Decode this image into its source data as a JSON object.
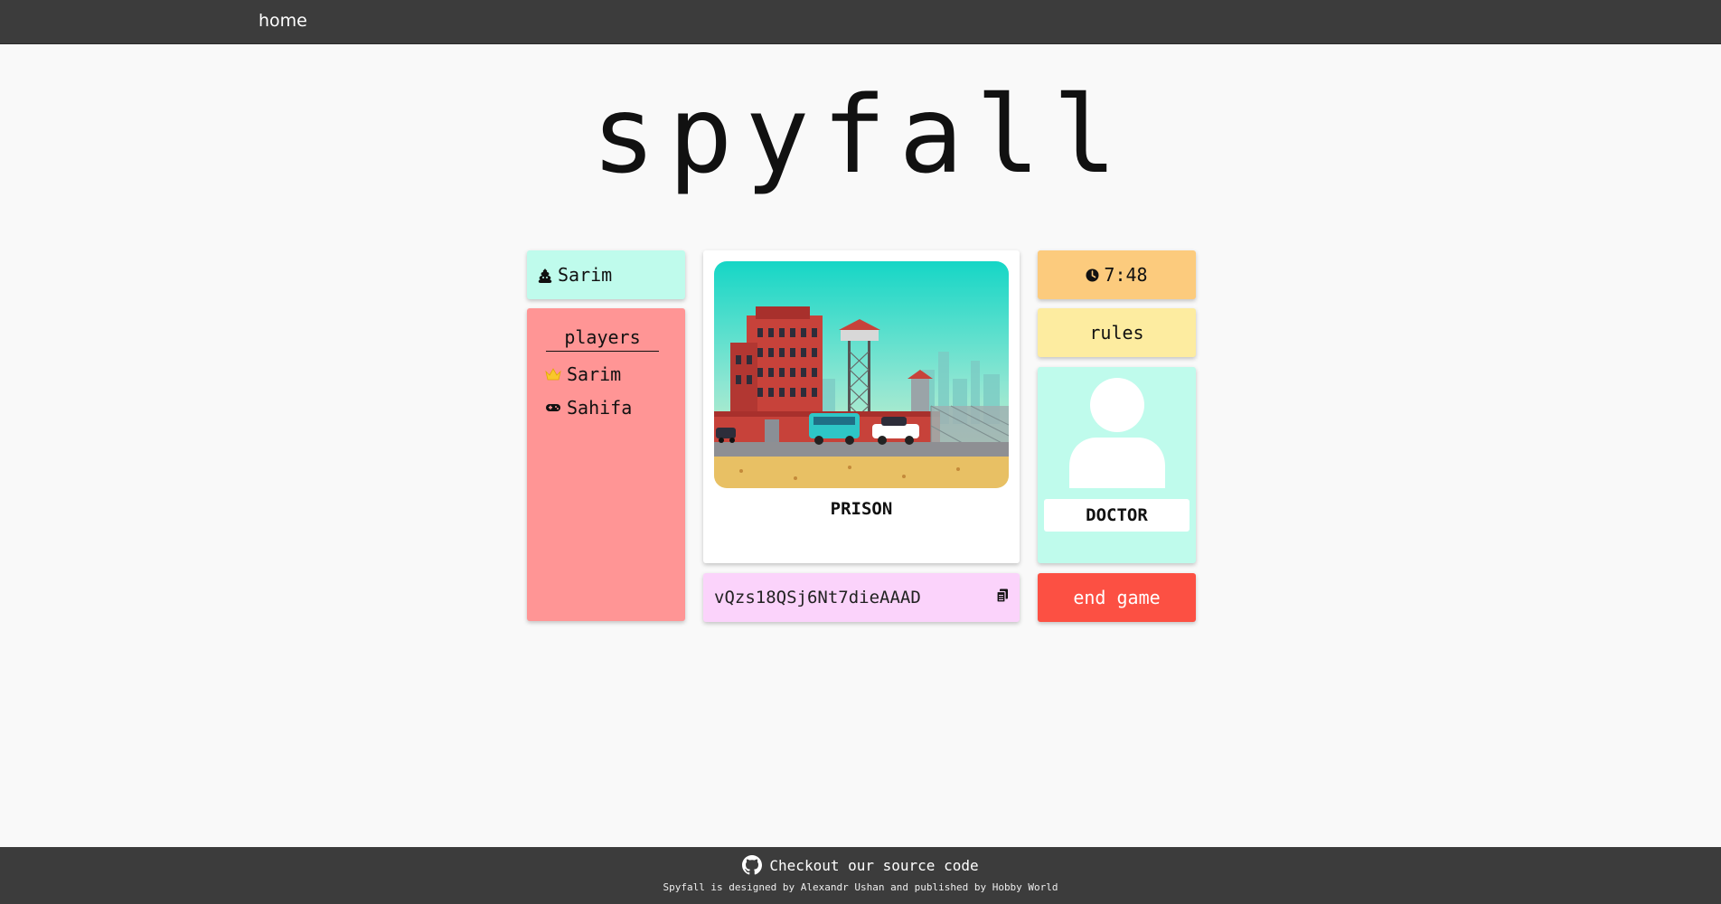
{
  "nav": {
    "home_label": "home"
  },
  "title": "spyfall",
  "me": {
    "name": "Sarim",
    "icon": "poop-icon"
  },
  "players": {
    "heading": "players",
    "list": [
      {
        "name": "Sarim",
        "icon": "crown-icon"
      },
      {
        "name": "Sahifa",
        "icon": "gamepad-icon"
      }
    ]
  },
  "location": {
    "name": "PRISON",
    "image": "prison-illustration"
  },
  "game_code": "vQzs18QSj6Nt7dieAAAD",
  "timer": {
    "value": "7:48",
    "icon": "clock-icon"
  },
  "rules_label": "rules",
  "role": {
    "name": "DOCTOR",
    "icon": "user-avatar-icon"
  },
  "end_game_label": "end game",
  "footer": {
    "source_label": "Checkout our source code",
    "credit": "Spyfall is designed by Alexandr Ushan and published by Hobby World"
  },
  "colors": {
    "nav_bg": "#3c3c3c",
    "mint": "#bffbec",
    "salmon": "#ff9595",
    "pink": "#fbd3fb",
    "orange": "#fccb7d",
    "yellow": "#fdeca0",
    "red": "#fc5043"
  }
}
